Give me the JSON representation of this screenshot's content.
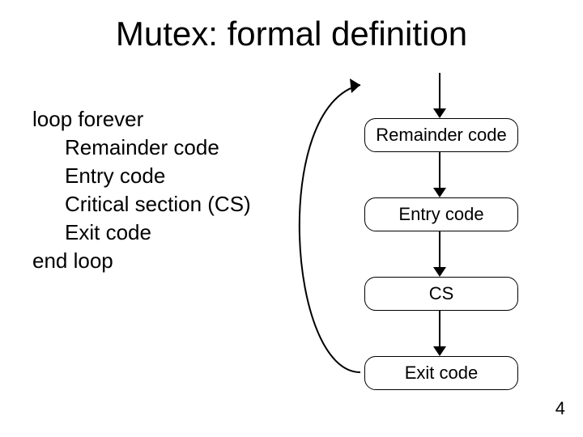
{
  "title": "Mutex: formal definition",
  "pseudocode": {
    "line1": "loop forever",
    "line2": "Remainder code",
    "line3": "Entry code",
    "line4": "Critical section (CS)",
    "line5": "Exit code",
    "line6": "end loop"
  },
  "flow": {
    "node1": "Remainder code",
    "node2": "Entry code",
    "node3": "CS",
    "node4": "Exit code"
  },
  "page_number": "4"
}
